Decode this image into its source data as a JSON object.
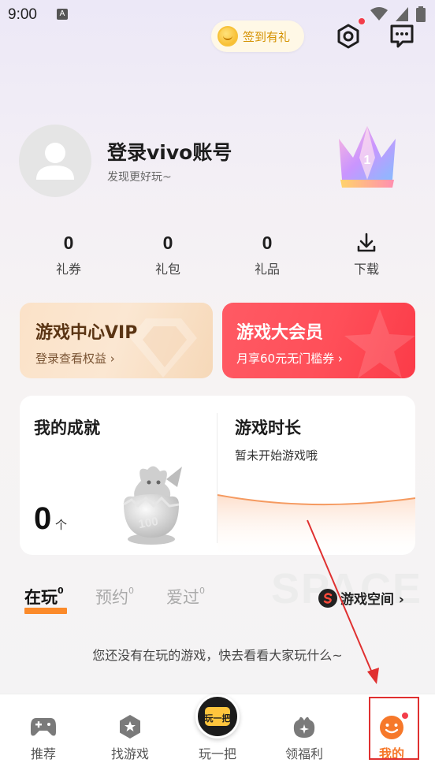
{
  "status_bar": {
    "time": "9:00",
    "notification_glyph": "A",
    "icons": [
      "wifi-icon",
      "signal-icon",
      "battery-icon"
    ]
  },
  "header": {
    "signin_label": "签到有礼",
    "icons": [
      "coin-icon",
      "settings-icon",
      "message-icon"
    ]
  },
  "profile": {
    "login_title": "登录vivo账号",
    "login_subtitle": "发现更好玩~",
    "crown_level": "1"
  },
  "stats": [
    {
      "value": "0",
      "label": "礼券"
    },
    {
      "value": "0",
      "label": "礼包"
    },
    {
      "value": "0",
      "label": "礼品"
    },
    {
      "label": "下载",
      "icon": "download-icon"
    }
  ],
  "vip_card": {
    "title": "游戏中心VIP",
    "subtitle": "登录查看权益 ›"
  },
  "member_card": {
    "title": "游戏大会员",
    "subtitle": "月享60元无门槛券 ›"
  },
  "achievement": {
    "title": "我的成就",
    "count": "0",
    "unit": "个",
    "badge_text": "100"
  },
  "playtime": {
    "title": "游戏时长",
    "subtitle": "暂未开始游戏哦"
  },
  "tabs": [
    {
      "label": "在玩",
      "count": "0",
      "active": true
    },
    {
      "label": "预约",
      "count": "0",
      "active": false
    },
    {
      "label": "爱过",
      "count": "0",
      "active": false
    }
  ],
  "game_space": {
    "watermark": "SPACE",
    "label": "游戏空间 ›"
  },
  "empty_message": "您还没有在玩的游戏，快去看看大家玩什么~",
  "bottom_nav": {
    "items": [
      {
        "label": "推荐",
        "icon": "gamepad-icon"
      },
      {
        "label": "找游戏",
        "icon": "star-hexagon-icon"
      },
      {
        "label": "玩一把",
        "icon": "play-badge-icon",
        "badge_text": "玩一把"
      },
      {
        "label": "领福利",
        "icon": "gift-bag-icon"
      },
      {
        "label": "我的",
        "icon": "smile-icon",
        "active": true
      }
    ]
  },
  "colors": {
    "accent_orange": "#f6782a",
    "member_red": "#ff4f59",
    "vip_gold": "#fbe2c8",
    "badge_red": "#f33d4a",
    "annotation_red": "#e03030"
  }
}
